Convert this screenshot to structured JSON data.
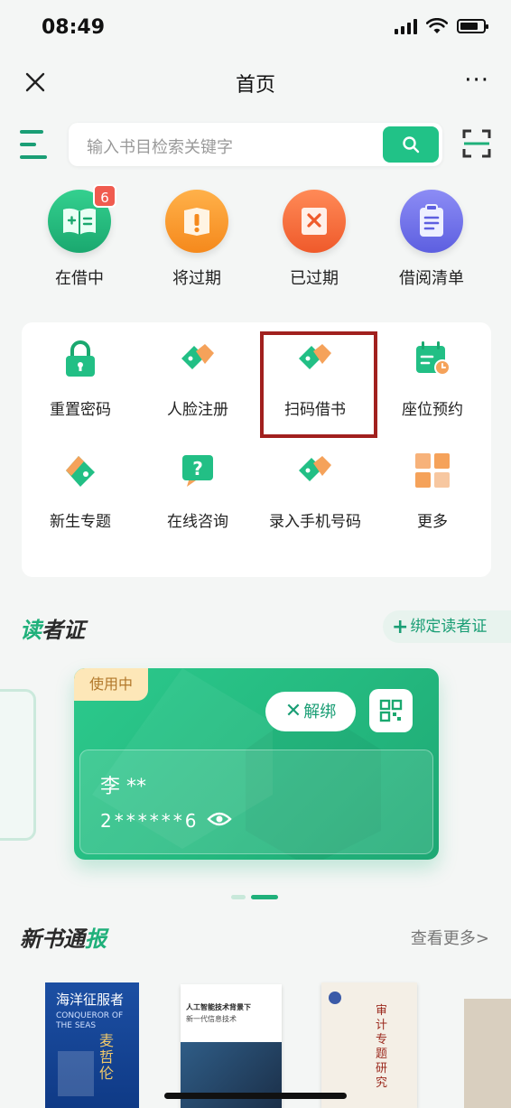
{
  "status_bar": {
    "time": "08:49"
  },
  "nav": {
    "title": "首页",
    "more": "···"
  },
  "search": {
    "placeholder": "输入书目检索关键字"
  },
  "quick_actions": [
    {
      "label": "在借中",
      "badge": "6"
    },
    {
      "label": "将过期"
    },
    {
      "label": "已过期"
    },
    {
      "label": "借阅清单"
    }
  ],
  "services": [
    {
      "label": "重置密码"
    },
    {
      "label": "人脸注册"
    },
    {
      "label": "扫码借书"
    },
    {
      "label": "座位预约"
    },
    {
      "label": "新生专题"
    },
    {
      "label": "在线咨询"
    },
    {
      "label": "录入手机号码"
    },
    {
      "label": "更多"
    }
  ],
  "reader_section": {
    "title_first": "读",
    "title_rest": "者证",
    "bind_label": "绑定读者证"
  },
  "reader_card": {
    "status": "使用中",
    "unbind_label": "解绑",
    "name": "李 **",
    "number": "2******6"
  },
  "new_books": {
    "title_a": "新书通",
    "title_b": "报",
    "more_label": "查看更多>"
  },
  "books": [
    {
      "title": "海洋征服者",
      "subtitle": "CONQUEROR OF THE SEAS",
      "author": "麦哲伦"
    },
    {
      "title": "人工智能技术背景下",
      "subtitle": "新一代信息技术"
    },
    {
      "title": "审计专题研究"
    },
    {
      "title": ""
    }
  ],
  "colors": {
    "brand_green": "#21c287",
    "highlight_red": "#a1201e",
    "badge_red": "#f05b4f"
  }
}
